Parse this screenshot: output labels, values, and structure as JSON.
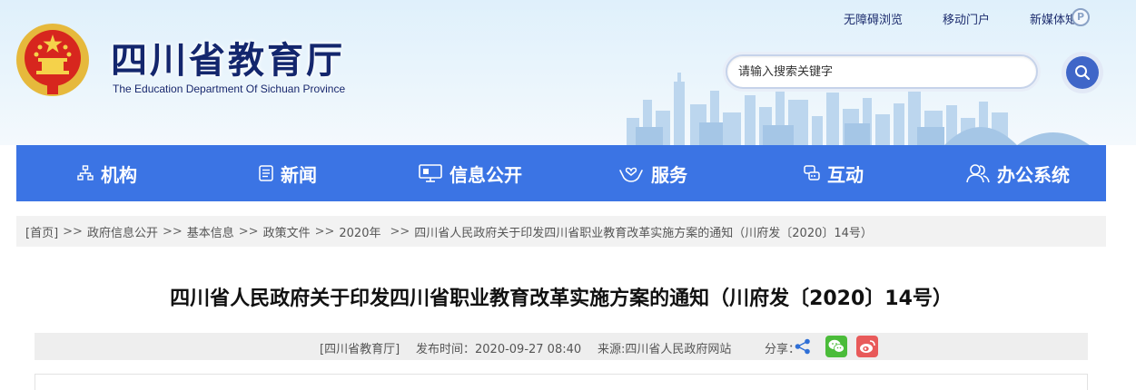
{
  "header": {
    "site_title": "四川省教育厅",
    "site_subtitle": "The Education Department Of Sichuan Province",
    "emblem_icon": "national-emblem-icon",
    "top_links": [
      {
        "label": "无障碍浏览"
      },
      {
        "label": "移动门户"
      },
      {
        "label": "新媒体矩阵"
      }
    ],
    "search": {
      "placeholder": "请输入搜索关键字",
      "value": "",
      "button_icon": "search-icon"
    }
  },
  "nav": {
    "items": [
      {
        "label": "机构",
        "icon": "org-chart-icon"
      },
      {
        "label": "新闻",
        "icon": "newspaper-icon"
      },
      {
        "label": "信息公开",
        "icon": "monitor-icon"
      },
      {
        "label": "服务",
        "icon": "hands-heart-icon"
      },
      {
        "label": "互动",
        "icon": "chat-icon"
      },
      {
        "label": "办公系统",
        "icon": "users-icon"
      }
    ]
  },
  "breadcrumb": {
    "items": [
      "[首页]",
      "政府信息公开",
      "基本信息",
      "政策文件",
      "2020年",
      "四川省人民政府关于印发四川省职业教育改革实施方案的通知（川府发〔2020〕14号）"
    ],
    "separator": ">>"
  },
  "article": {
    "title": "四川省人民政府关于印发四川省职业教育改革实施方案的通知（川府发〔2020〕14号）",
    "meta": {
      "source_unit": "[四川省教育厅]",
      "publish_time": "发布时间：2020-09-27 08:40",
      "origin": "来源:四川省人民政府网站",
      "share_label": "分享："
    },
    "share_icons": [
      "share-icon",
      "wechat-icon",
      "weibo-icon"
    ]
  },
  "colors": {
    "nav_bg": "#3b74e4",
    "title_blue": "#13266d",
    "search_button": "#3f66c8",
    "breadcrumb_bg": "#f2f2f2",
    "meta_bg": "#eeeeee"
  }
}
